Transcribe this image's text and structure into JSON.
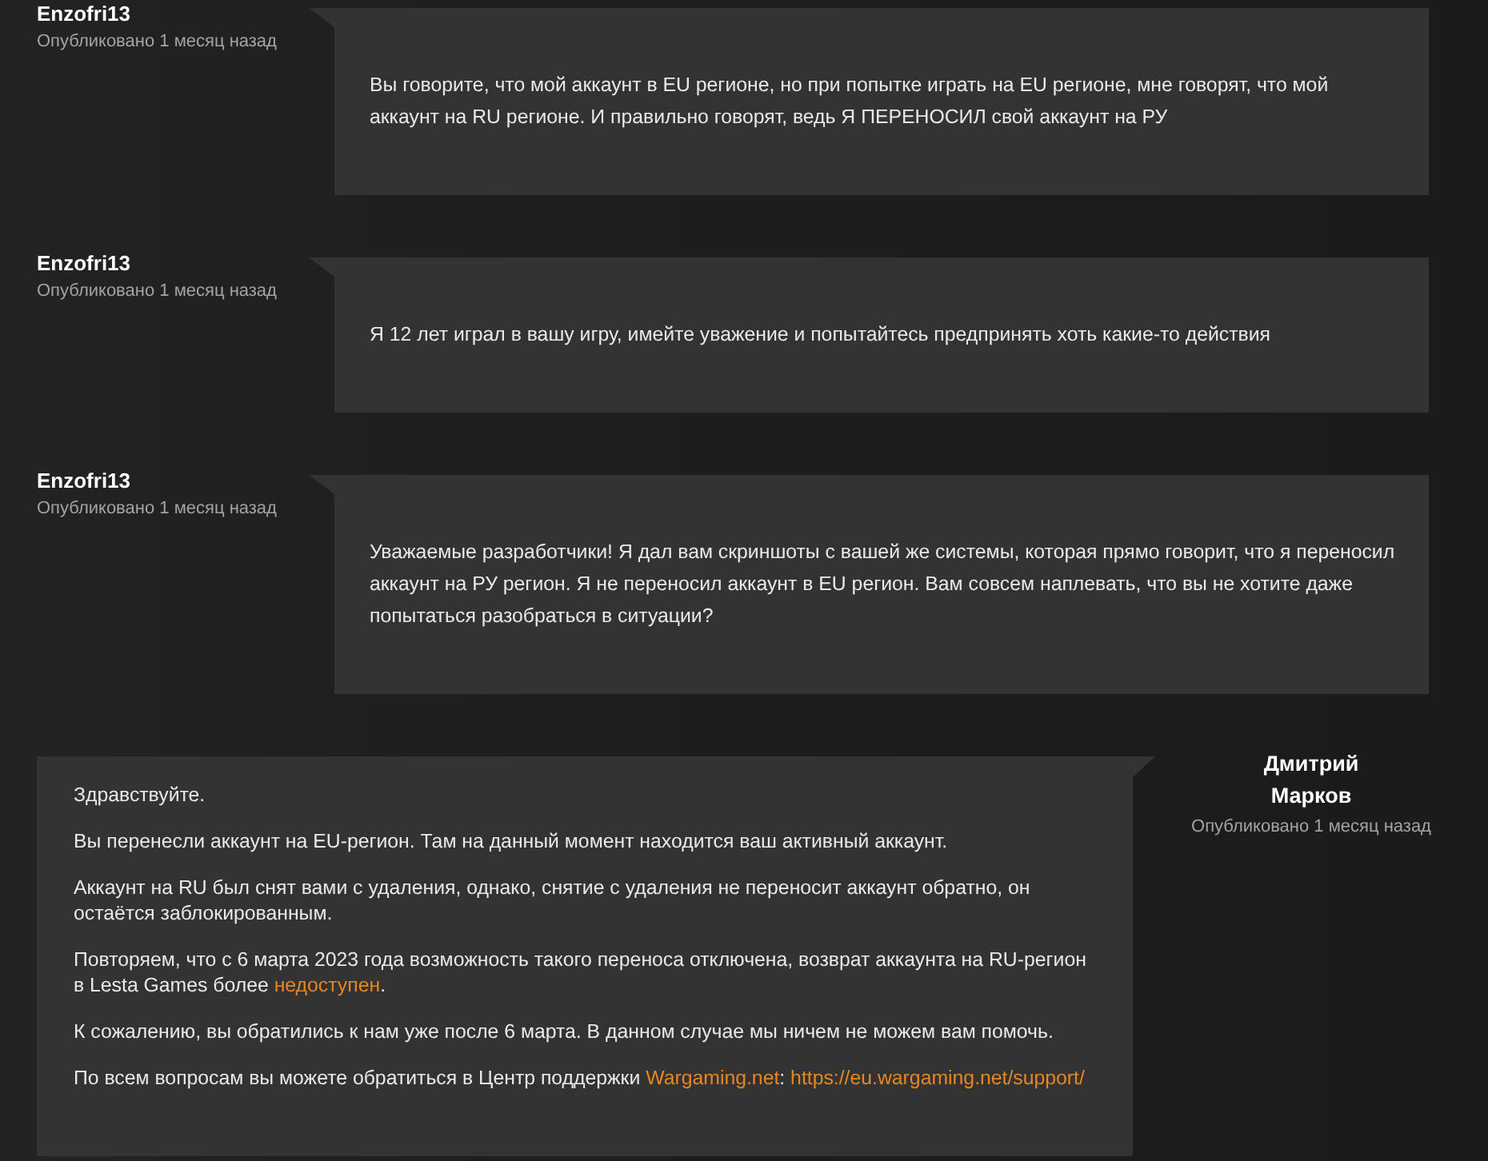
{
  "posts": [
    {
      "kind": "player",
      "author": "Enzofri13",
      "published": "Опубликовано 1 месяц назад",
      "paragraphs": [
        [
          {
            "kind": "text",
            "text": "Вы говорите, что мой аккаунт в EU регионе, но при попытке играть на EU регионе, мне говорят, что мой аккаунт на RU регионе. И правильно говорят, ведь Я ПЕРЕНОСИЛ свой аккаунт на РУ"
          }
        ]
      ]
    },
    {
      "kind": "player",
      "author": "Enzofri13",
      "published": "Опубликовано 1 месяц назад",
      "paragraphs": [
        [
          {
            "kind": "text",
            "text": "Я 12 лет играл в вашу игру, имейте уважение и попытайтесь предпринять хоть какие-то действия"
          }
        ]
      ]
    },
    {
      "kind": "player",
      "author": "Enzofri13",
      "published": "Опубликовано 1 месяц назад",
      "paragraphs": [
        [
          {
            "kind": "text",
            "text": "Уважаемые разработчики! Я дал вам скриншоты с вашей же системы, которая прямо говорит, что я переносил аккаунт на РУ регион. Я не переносил аккаунт в EU регион. Вам совсем наплевать, что вы не хотите даже попытаться разобраться в ситуации?"
          }
        ]
      ]
    },
    {
      "kind": "staff",
      "author": "Дмитрий Марков",
      "published": "Опубликовано 1 месяц назад",
      "paragraphs": [
        [
          {
            "kind": "text",
            "text": "Здравствуйте."
          }
        ],
        [
          {
            "kind": "text",
            "text": "Вы перенесли аккаунт на EU-регион. Там на данный момент находится ваш активный аккаунт."
          }
        ],
        [
          {
            "kind": "text",
            "text": "Аккаунт на RU был снят вами с удаления, однако, снятие с удаления не переносит аккаунт обратно, он остаётся заблокированным."
          }
        ],
        [
          {
            "kind": "text",
            "text": "Повторяем, что с 6 марта 2023 года возможность такого переноса отключена, возврат аккаунта на RU-регион в Lesta Games более "
          },
          {
            "kind": "link",
            "text": "недоступен"
          },
          {
            "kind": "text",
            "text": "."
          }
        ],
        [
          {
            "kind": "text",
            "text": "К сожалению, вы обратились к нам уже после 6 марта. В данном случае мы ничем не можем вам помочь."
          }
        ],
        [
          {
            "kind": "text",
            "text": "По всем вопросам вы можете обратиться в Центр поддержки "
          },
          {
            "kind": "link",
            "text": "Wargaming.net"
          },
          {
            "kind": "text",
            "text": ": "
          },
          {
            "kind": "link",
            "text": "https://eu.wargaming.net/support/"
          }
        ]
      ]
    }
  ]
}
